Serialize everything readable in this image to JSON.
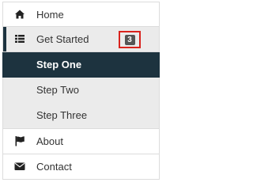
{
  "menu": {
    "home": {
      "label": "Home",
      "icon": "home-icon"
    },
    "get_started": {
      "label": "Get Started",
      "icon": "list-icon",
      "badge": "3",
      "steps": [
        {
          "label": "Step One",
          "state": "current"
        },
        {
          "label": "Step Two",
          "state": "default"
        },
        {
          "label": "Step Three",
          "state": "default"
        }
      ]
    },
    "about": {
      "label": "About",
      "icon": "flag-icon"
    },
    "contact": {
      "label": "Contact",
      "icon": "envelope-icon"
    }
  },
  "colors": {
    "accent_dark": "#1d333f",
    "badge_bg": "#555555",
    "highlight_border": "#d9231d",
    "submenu_bg": "#ebebeb"
  }
}
